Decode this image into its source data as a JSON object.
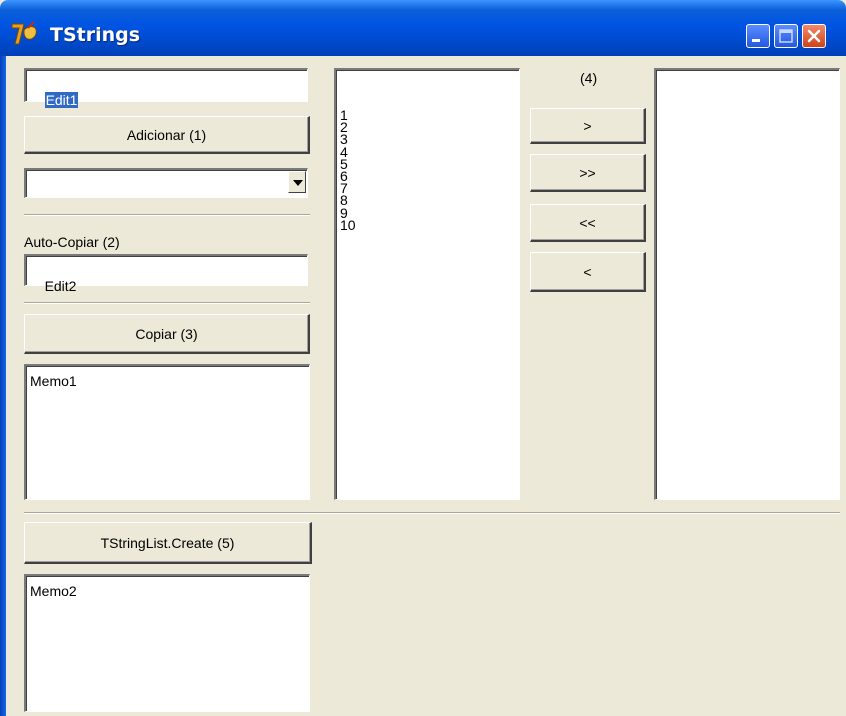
{
  "window": {
    "title": "TStrings",
    "icon": "delphi-app-icon",
    "buttons": [
      "minimize-icon",
      "maximize-icon",
      "close-icon"
    ]
  },
  "edit1": {
    "value": "Edit1"
  },
  "add_button": {
    "label": "Adicionar (1)"
  },
  "combobox": {
    "value": ""
  },
  "auto_copy": {
    "label": "Auto-Copiar (2)",
    "edit_value": "Edit2"
  },
  "copy_button": {
    "label": "Copiar (3)"
  },
  "memo1": {
    "value": "Memo1"
  },
  "listbox_left": {
    "items": [
      "1",
      "2",
      "3",
      "4",
      "5",
      "6",
      "7",
      "8",
      "9",
      "10"
    ]
  },
  "transfer": {
    "label": "(4)",
    "move_one_right": ">",
    "move_all_right": ">>",
    "move_all_left": "<<",
    "move_one_left": "<"
  },
  "listbox_right": {
    "items": []
  },
  "create_button": {
    "label": "TStringList.Create (5)"
  },
  "memo2": {
    "value": "Memo2"
  },
  "colors": {
    "titlebar": "#0054e3",
    "face": "#ece9d8",
    "selection": "#316ac5",
    "close": "#d2401a"
  }
}
